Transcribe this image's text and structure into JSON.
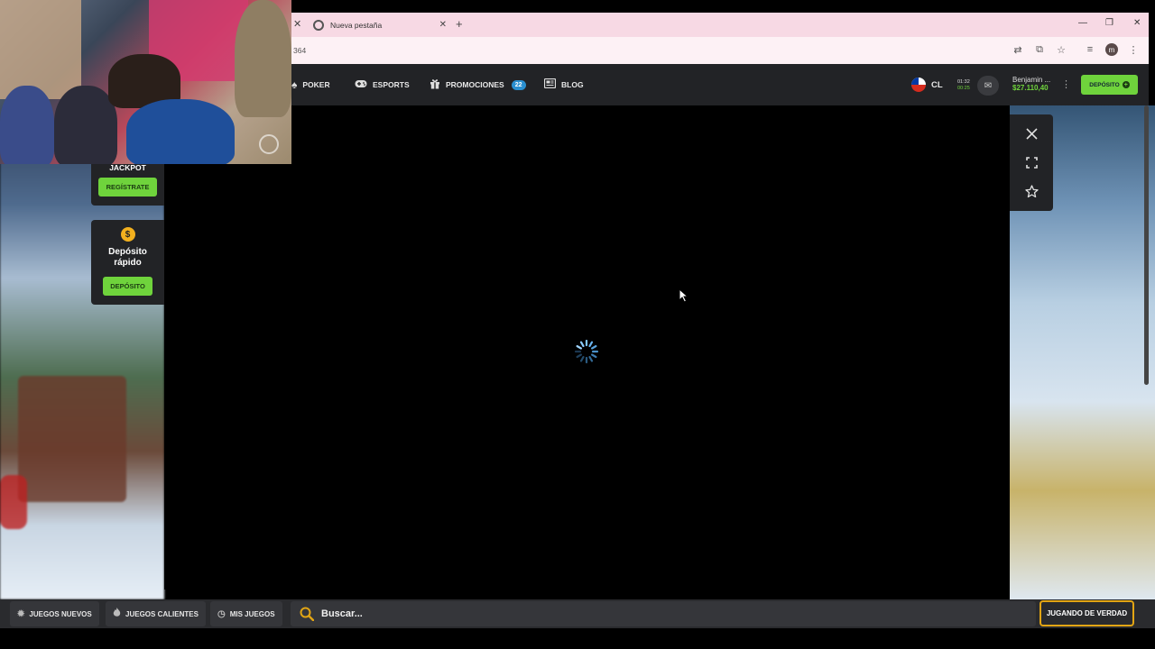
{
  "browser": {
    "tab_title": "Nueva pestaña",
    "url_fragment": "364",
    "profile_initial": "m"
  },
  "header": {
    "nav": [
      {
        "label": "POKER",
        "icon": "spade-icon"
      },
      {
        "label": "ESPORTS",
        "icon": "gamepad-icon"
      },
      {
        "label": "PROMOCIONES",
        "icon": "gift-icon",
        "badge": "22"
      },
      {
        "label": "BLOG",
        "icon": "newspaper-icon"
      }
    ],
    "country_code": "CL",
    "time_line1": "01:32",
    "time_line2": "00:25",
    "user_name": "Benjamin ...",
    "balance": "$27.110,40",
    "deposit_label": "DEPÓSITO"
  },
  "sidebar": {
    "jackpot_label": "JACKPOT",
    "register_label": "REGÍSTRATE",
    "quick_deposit_label": "Depósito rápido",
    "deposit_label": "DEPÓSITO",
    "coin_symbol": "$"
  },
  "game": {
    "state": "loading"
  },
  "bottom": {
    "new_games": "JUEGOS NUEVOS",
    "hot_games": "JUEGOS CALIENTES",
    "my_games": "MIS JUEGOS",
    "search_placeholder": "Buscar...",
    "real_play": "JUGANDO DE VERDAD"
  },
  "colors": {
    "accent_green": "#6fd33c",
    "accent_gold": "#e2a514",
    "header_bg": "#222326",
    "tab_bg": "#f7d9e4"
  }
}
